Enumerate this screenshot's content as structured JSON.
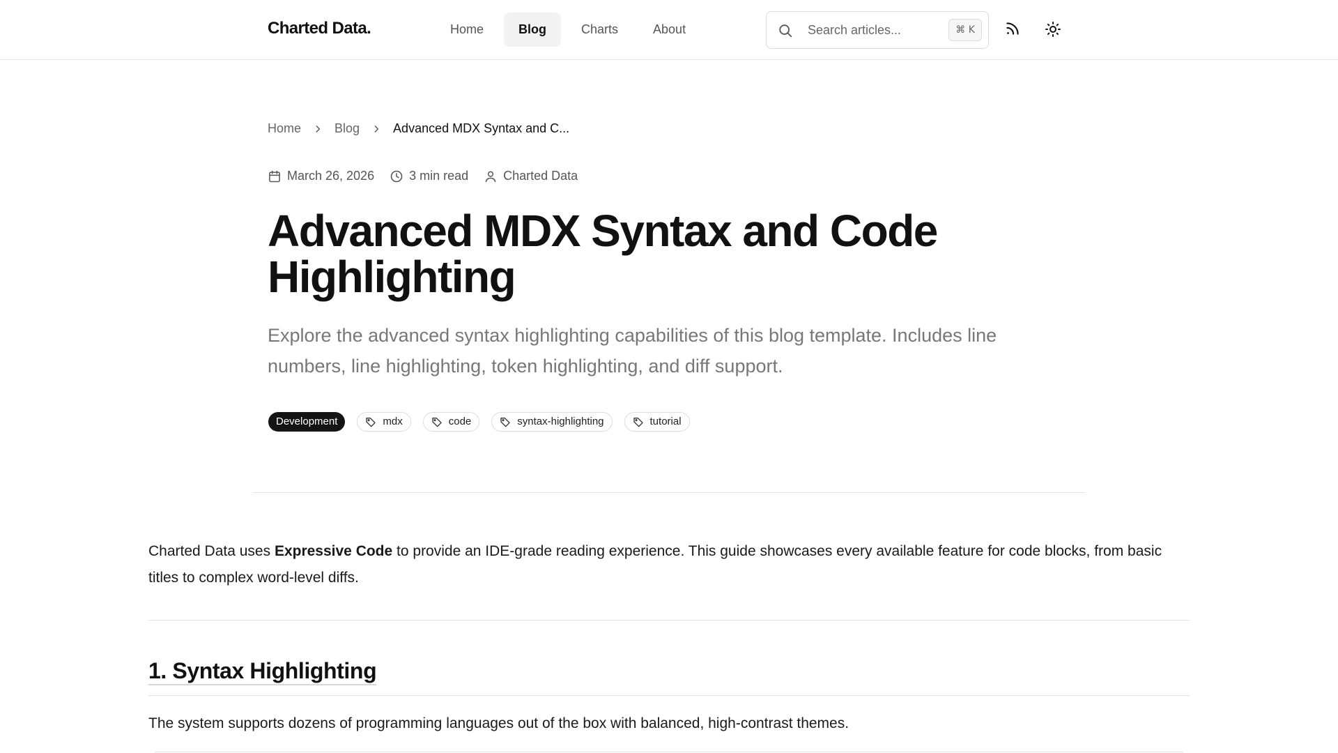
{
  "header": {
    "logo_text": "Charted Data",
    "logo_dot": ".",
    "nav": [
      {
        "label": "Home",
        "active": false
      },
      {
        "label": "Blog",
        "active": true
      },
      {
        "label": "Charts",
        "active": false
      },
      {
        "label": "About",
        "active": false
      }
    ],
    "search": {
      "placeholder": "Search articles...",
      "shortcut": "⌘ K",
      "icon": "search-icon"
    },
    "rss_icon": "rss-icon",
    "theme_icon": "sun-icon"
  },
  "breadcrumb": {
    "items": [
      "Home",
      "Blog",
      "Advanced MDX Syntax and C..."
    ]
  },
  "meta": {
    "date": "March 26, 2026",
    "read_time": "3 min read",
    "author": "Charted Data"
  },
  "article": {
    "title": "Advanced MDX Syntax and Code Highlighting",
    "subtitle": "Explore the advanced syntax highlighting capabilities of this blog template. Includes line numbers, line highlighting, token highlighting, and diff support.",
    "category": "Development",
    "tags": [
      "mdx",
      "code",
      "syntax-highlighting",
      "tutorial"
    ],
    "intro_before": "Charted Data uses ",
    "intro_bold": "Expressive Code",
    "intro_after": " to provide an IDE-grade reading experience. This guide showcases every available feature for code blocks, from basic titles to complex word-level diffs.",
    "section_heading": "1. Syntax Highlighting",
    "section_text": "The system supports dozens of programming languages out of the box with balanced, high-contrast themes."
  },
  "colors": {
    "accent": "#141414",
    "muted_text": "#777777",
    "border": "#e2e2e2"
  }
}
